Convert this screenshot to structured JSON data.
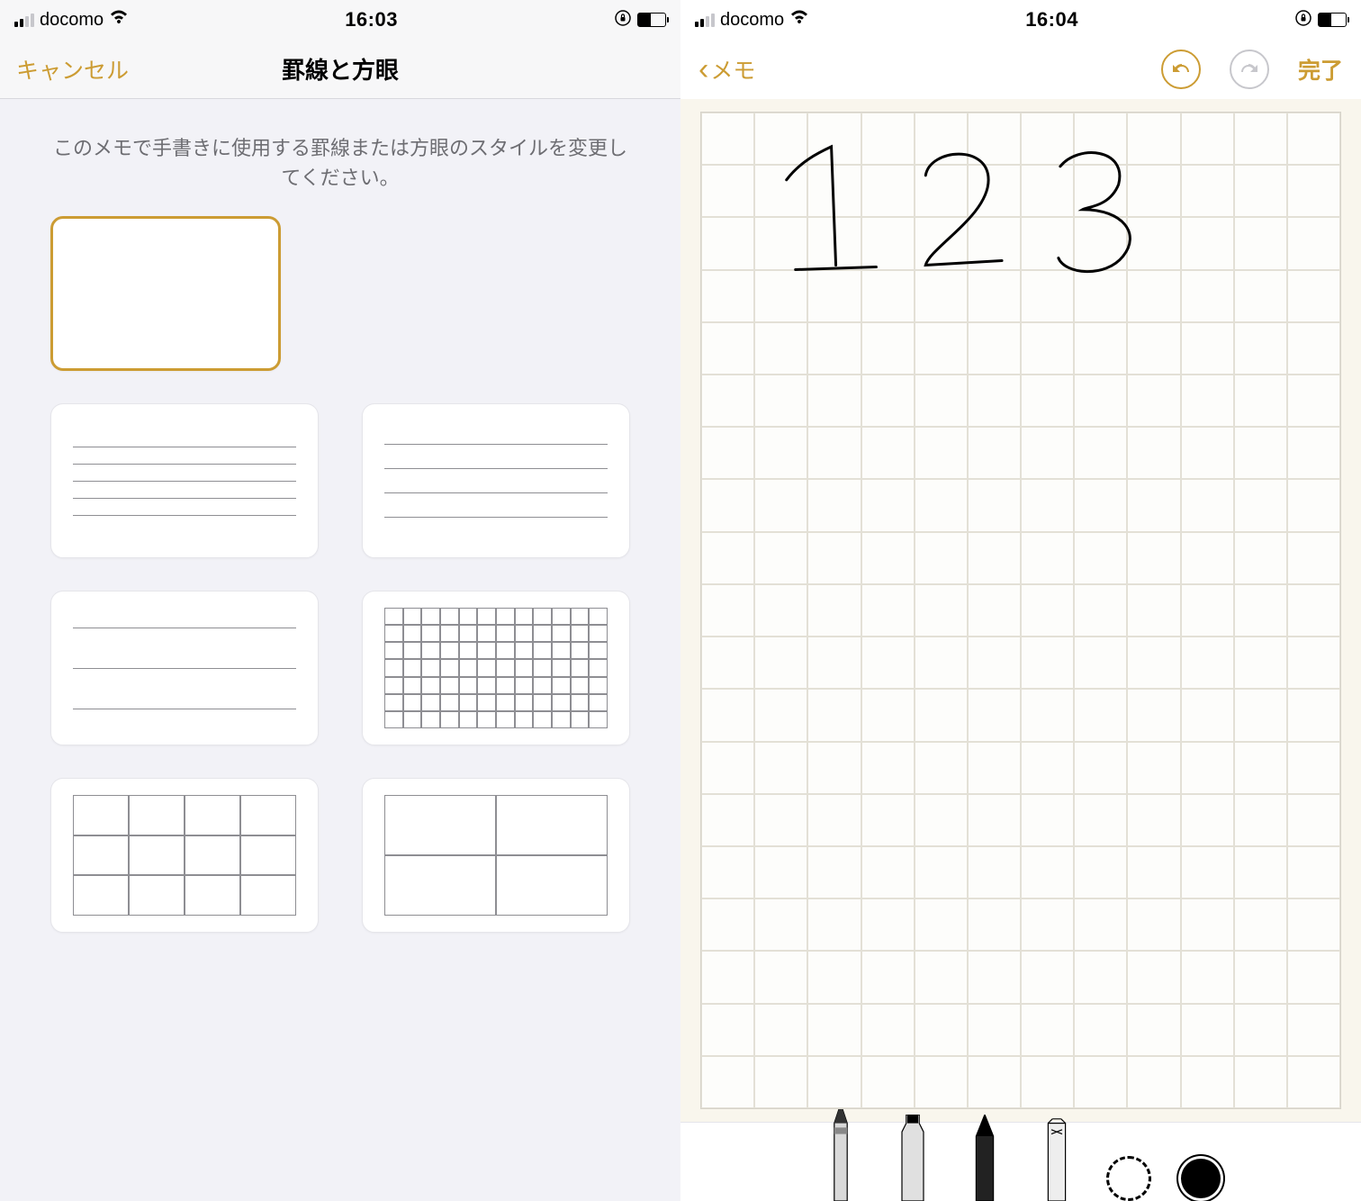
{
  "left": {
    "status": {
      "carrier": "docomo",
      "time": "16:03"
    },
    "nav": {
      "cancel": "キャンセル",
      "title": "罫線と方眼"
    },
    "description": "このメモで手書きに使用する罫線または方眼のスタイルを変更してください。",
    "styles": [
      {
        "id": "blank",
        "type": "blank",
        "selected": true
      },
      {
        "id": "lines-dense",
        "type": "lines-5",
        "selected": false
      },
      {
        "id": "lines-mid",
        "type": "lines-4",
        "selected": false
      },
      {
        "id": "lines-wide",
        "type": "lines-3",
        "selected": false
      },
      {
        "id": "grid-small",
        "type": "grid-12x7",
        "selected": false
      },
      {
        "id": "grid-mid",
        "type": "grid-4x3",
        "selected": false
      },
      {
        "id": "grid-large",
        "type": "grid-2x2",
        "selected": false
      }
    ]
  },
  "right": {
    "status": {
      "carrier": "docomo",
      "time": "16:04"
    },
    "nav": {
      "back": "メモ",
      "done": "完了"
    },
    "handwriting": [
      "1",
      "2",
      "3"
    ],
    "tools": [
      {
        "id": "pen",
        "selected": true
      },
      {
        "id": "marker",
        "selected": false
      },
      {
        "id": "pencil",
        "selected": false
      },
      {
        "id": "eraser",
        "selected": false
      },
      {
        "id": "lasso",
        "selected": false
      },
      {
        "id": "color",
        "value": "#000000"
      }
    ]
  },
  "colors": {
    "accent": "#cc9c33"
  }
}
